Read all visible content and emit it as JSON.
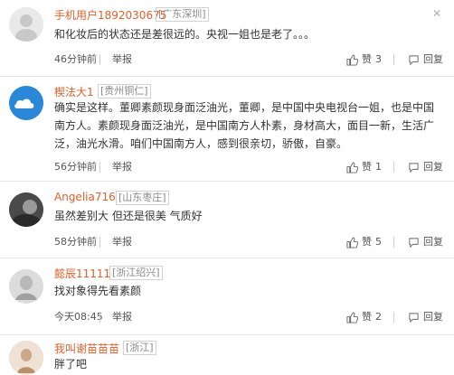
{
  "comments": [
    {
      "username": "手机用户1892030675",
      "location": "[广东深圳]",
      "text": "和化妆后的状态还是差很远的。央视一姐也是老了。。。",
      "time": "46分钟前",
      "report": "举报",
      "like_label": "赞",
      "likes": "3",
      "reply": "回复",
      "avatar_icon": "default-user-avatar"
    },
    {
      "username": "楔法大1",
      "location": "[贵州铜仁]",
      "text": "确实是这样。董卿素颜现身面泛油光，董卿，是中国中央电视台一姐，也是中国南方人。素颜现身面泛油光，是中国南方人朴素，身材高大，面目一新，生活广泛，油光水滑。咱们中国南方人，感到很亲切，骄傲，自豪。",
      "time": "56分钟前",
      "report": "举报",
      "like_label": "赞",
      "likes": "1",
      "reply": "回复",
      "avatar_icon": "blue-cloud-avatar"
    },
    {
      "username": "Angelia716",
      "location": "[山东枣庄]",
      "text": "虽然差别大 但还是很美 气质好",
      "time": "58分钟前",
      "report": "举报",
      "like_label": "赞",
      "likes": "5",
      "reply": "回复",
      "avatar_icon": "photo-avatar"
    },
    {
      "username": "懿辰11111",
      "location": "[浙江绍兴]",
      "text": "找对象得先看素颜",
      "time": "今天08:45",
      "report": "举报",
      "like_label": "赞",
      "likes": "2",
      "reply": "回复",
      "avatar_icon": "photo-avatar"
    },
    {
      "username": "我叫谢苗苗苗",
      "location": "[浙江]",
      "text": "胖了吧",
      "avatar_icon": "photo-avatar"
    }
  ],
  "colors": {
    "username": "#e0602c",
    "meta_text": "#555555",
    "divider": "#e6e6e6"
  }
}
